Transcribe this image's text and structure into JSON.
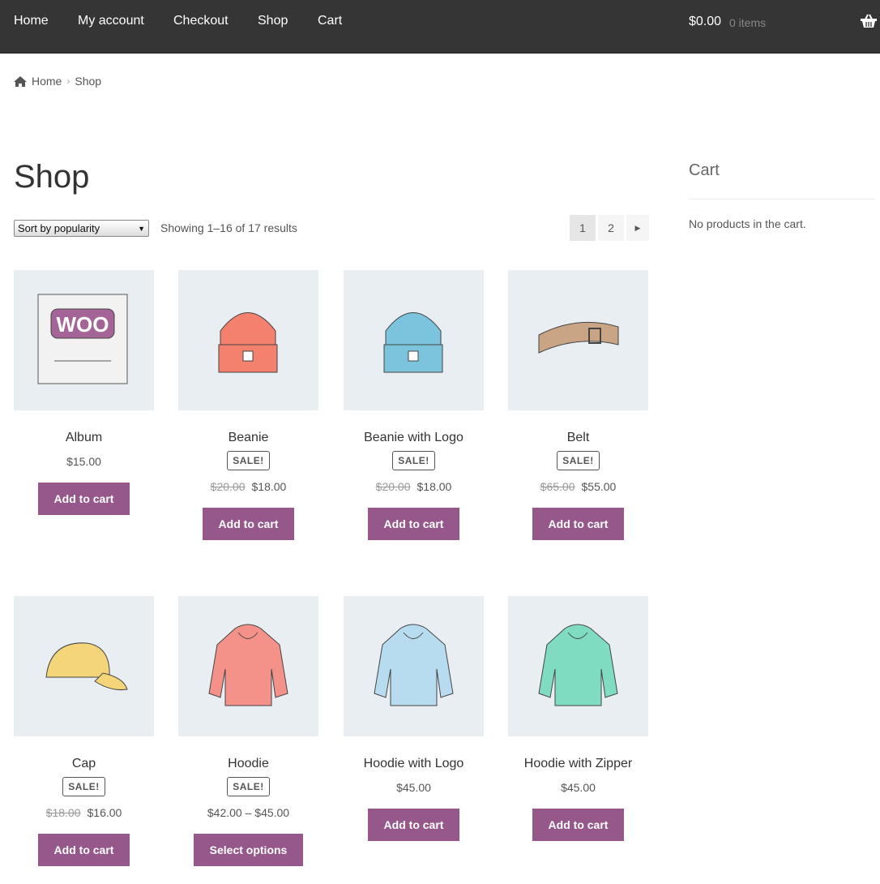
{
  "nav": {
    "items": [
      "Home",
      "My account",
      "Checkout",
      "Shop",
      "Cart"
    ],
    "cart_total": "$0.00",
    "cart_count": "0 items"
  },
  "breadcrumb": [
    "Home",
    "Shop"
  ],
  "page_title": "Shop",
  "toolbar": {
    "sort_selected": "Sort by popularity",
    "result_count": "Showing 1–16 of 17 results",
    "pages": [
      "1",
      "2"
    ],
    "current_page": "1"
  },
  "sidebar": {
    "title": "Cart",
    "empty": "No products in the cart."
  },
  "colors": {
    "button": "#96588a",
    "header": "#353535"
  },
  "products": [
    {
      "name": "Album",
      "sale": "",
      "old": "",
      "price": "$15.00",
      "button": "Add to cart",
      "image": "album",
      "color": "#a46497"
    },
    {
      "name": "Beanie",
      "sale": "SALE!",
      "old": "$20.00",
      "price": "$18.00",
      "button": "Add to cart",
      "image": "beanie",
      "color": "#f4806e"
    },
    {
      "name": "Beanie with Logo",
      "sale": "SALE!",
      "old": "$20.00",
      "price": "$18.00",
      "button": "Add to cart",
      "image": "beanie",
      "color": "#7cc3dd"
    },
    {
      "name": "Belt",
      "sale": "SALE!",
      "old": "$65.00",
      "price": "$55.00",
      "button": "Add to cart",
      "image": "belt",
      "color": "#c9a586"
    },
    {
      "name": "Cap",
      "sale": "SALE!",
      "old": "$18.00",
      "price": "$16.00",
      "button": "Add to cart",
      "image": "cap",
      "color": "#f5d57a"
    },
    {
      "name": "Hoodie",
      "sale": "SALE!",
      "old": "",
      "price": "$42.00 – $45.00",
      "button": "Select options",
      "image": "hoodie",
      "color": "#f4928a"
    },
    {
      "name": "Hoodie with Logo",
      "sale": "",
      "old": "",
      "price": "$45.00",
      "button": "Add to cart",
      "image": "hoodie",
      "color": "#b8dcef"
    },
    {
      "name": "Hoodie with Zipper",
      "sale": "",
      "old": "",
      "price": "$45.00",
      "button": "Add to cart",
      "image": "hoodie",
      "color": "#7fdcc0"
    }
  ]
}
